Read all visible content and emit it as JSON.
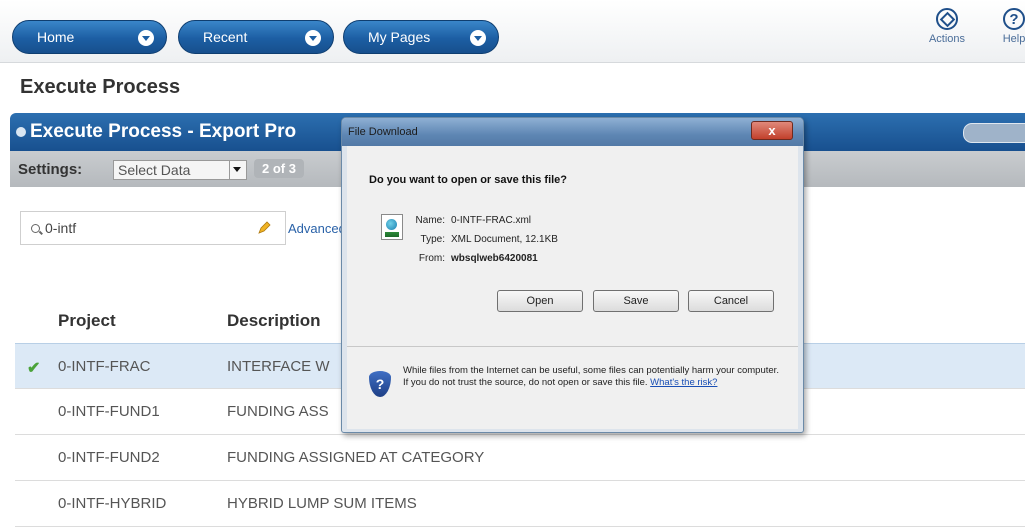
{
  "nav": {
    "home": "Home",
    "recent": "Recent",
    "my_pages": "My Pages",
    "actions": "Actions",
    "help": "Help"
  },
  "page_title": "Execute Process",
  "panel": {
    "title": "Execute Process - Export Pro",
    "settings_label": "Settings:",
    "select_value": "Select Data",
    "page_indicator": "2 of 3"
  },
  "search": {
    "value": "0-intf",
    "advanced_link": "Advanced"
  },
  "table": {
    "headers": [
      "Project",
      "Description"
    ],
    "rows": [
      {
        "project": "0-INTF-FRAC",
        "description": "INTERFACE W",
        "selected": true
      },
      {
        "project": "0-INTF-FUND1",
        "description": "FUNDING ASS",
        "selected": false
      },
      {
        "project": "0-INTF-FUND2",
        "description": "FUNDING ASSIGNED AT CATEGORY",
        "selected": false
      },
      {
        "project": "0-INTF-HYBRID",
        "description": "HYBRID LUMP SUM ITEMS",
        "selected": false
      }
    ]
  },
  "dialog": {
    "title": "File Download",
    "close": "x",
    "question": "Do you want to open or save this file?",
    "name_label": "Name:",
    "name_value": "0-INTF-FRAC.xml",
    "type_label": "Type:",
    "type_value": "XML Document, 12.1KB",
    "from_label": "From:",
    "from_value": "wbsqlweb6420081",
    "buttons": {
      "open": "Open",
      "save": "Save",
      "cancel": "Cancel"
    },
    "warning": "While files from the Internet can be useful, some files can potentially harm your computer. If you do not trust the source, do not open or save this file.",
    "risk_link": "What's the risk?"
  }
}
